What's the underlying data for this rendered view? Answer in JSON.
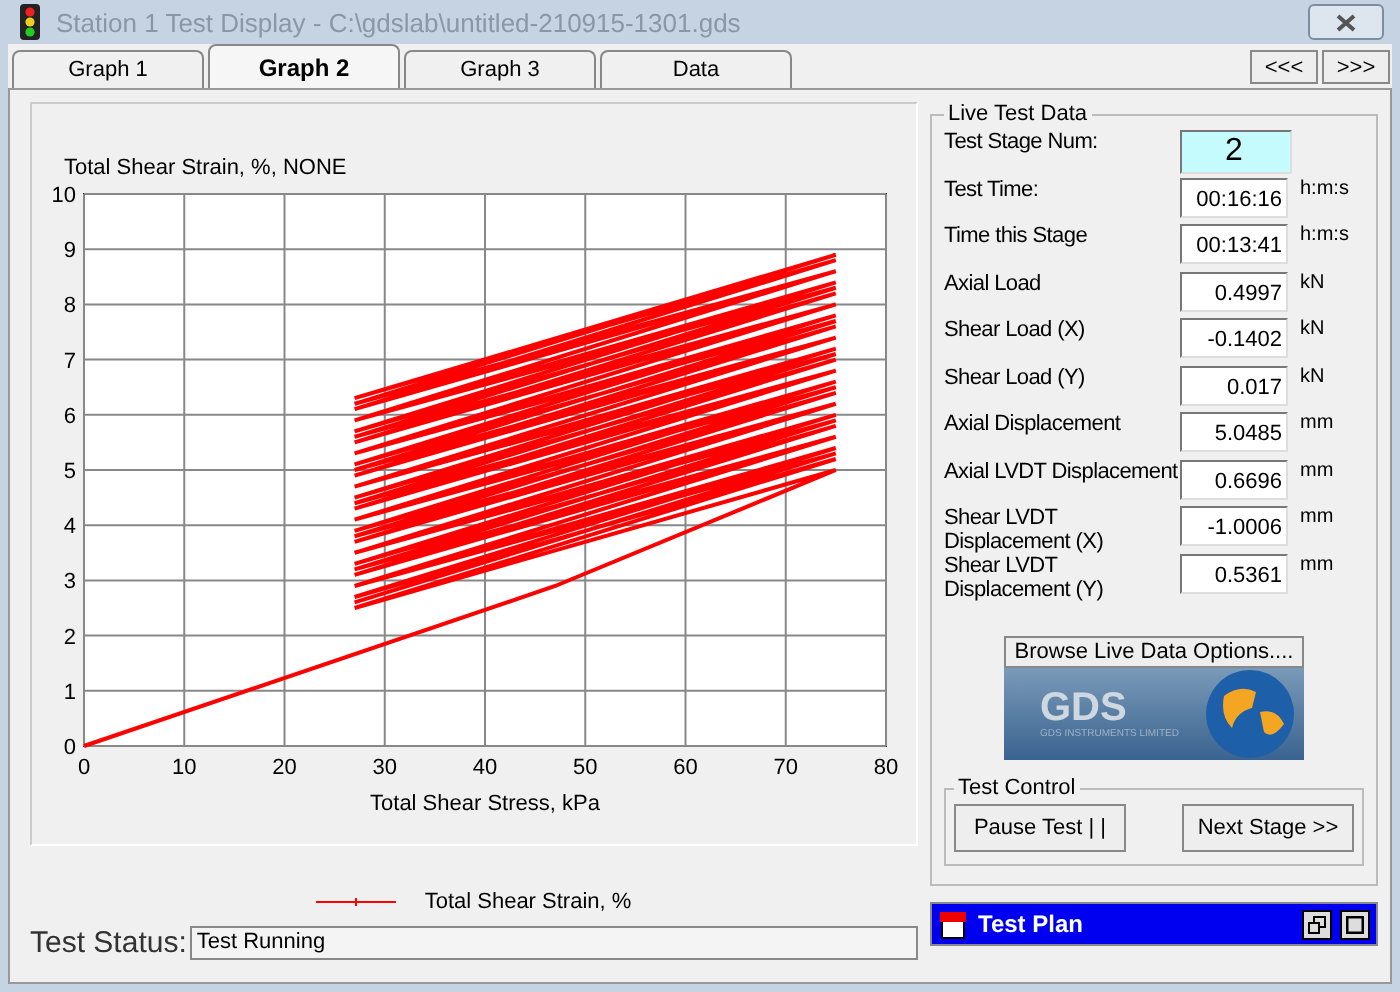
{
  "window": {
    "title": "Station 1 Test Display - C:\\gdslab\\untitled-210915-1301.gds"
  },
  "tabs": [
    {
      "label": "Graph 1",
      "selected": false
    },
    {
      "label": "Graph 2",
      "selected": true
    },
    {
      "label": "Graph 3",
      "selected": false
    },
    {
      "label": "Data",
      "selected": false
    }
  ],
  "nav_buttons": [
    "<<<",
    ">>>"
  ],
  "graph": {
    "chart_data": {
      "type": "line",
      "grid": true,
      "ylabel": "Total Shear Strain, %, NONE",
      "xlabel": "Total Shear Stress, kPa",
      "xlim": [
        0,
        80
      ],
      "ylim": [
        0,
        10
      ],
      "xticks": [
        0,
        10,
        20,
        30,
        40,
        50,
        60,
        70,
        80
      ],
      "yticks": [
        0,
        1,
        2,
        3,
        4,
        5,
        6,
        7,
        8,
        9,
        10
      ],
      "x": [
        0,
        47,
        75,
        27,
        75,
        27,
        75,
        27,
        75,
        27,
        75,
        27,
        75,
        27,
        75,
        27,
        75,
        27,
        75,
        27,
        75,
        27,
        75,
        27,
        75,
        27,
        75,
        27,
        75,
        27,
        75,
        27,
        75,
        27,
        75,
        27,
        75,
        27,
        75,
        27,
        75,
        27,
        75,
        27,
        75,
        27,
        75,
        27,
        75,
        27,
        75,
        27,
        75,
        27,
        75,
        27,
        75,
        27,
        75,
        27,
        75,
        27,
        75,
        27,
        75,
        27,
        75,
        27
      ],
      "series": [
        {
          "name": "Total Shear Strain, %",
          "color": "#ff0000",
          "values": [
            0,
            2.9,
            5.0,
            2.5,
            5.2,
            2.7,
            5.4,
            2.9,
            5.6,
            3.1,
            5.8,
            3.3,
            6.0,
            3.5,
            6.2,
            3.7,
            6.4,
            3.9,
            6.6,
            4.1,
            6.8,
            4.3,
            7.0,
            4.5,
            7.2,
            4.7,
            7.4,
            4.9,
            7.6,
            5.1,
            7.8,
            5.3,
            8.0,
            5.5,
            8.2,
            5.7,
            8.4,
            5.9,
            8.6,
            6.1,
            8.8,
            6.3,
            8.9,
            6.2,
            8.6,
            5.9,
            8.3,
            5.6,
            8.0,
            5.3,
            7.7,
            5.0,
            7.4,
            4.7,
            7.1,
            4.4,
            6.8,
            4.1,
            6.5,
            3.8,
            6.2,
            3.5,
            5.9,
            3.2,
            5.6,
            2.9,
            5.3,
            2.6
          ]
        }
      ]
    }
  },
  "live_data": {
    "title": "Live Test Data",
    "rows": [
      {
        "label": "Test Stage Num:",
        "value": "2",
        "highlighted": true
      },
      {
        "label": "Test Time:",
        "value": "00:16:16",
        "unit": "h:m:s",
        "highlighted": false
      },
      {
        "label": "Time this Stage",
        "value": "00:13:41",
        "unit": "h:m:s",
        "highlighted": false
      },
      {
        "label": "Axial Load",
        "value": "0.4997",
        "unit": "kN",
        "highlighted": false
      },
      {
        "label": "Shear Load (X)",
        "value": "-0.1402",
        "unit": "kN",
        "highlighted": false
      },
      {
        "label": "Shear Load (Y)",
        "value": "0.017",
        "unit": "kN",
        "highlighted": false
      },
      {
        "label": "Axial Displacement",
        "value": "5.0485",
        "unit": "mm",
        "highlighted": false
      },
      {
        "label": "Axial LVDT Displacement",
        "value": "0.6696",
        "unit": "mm",
        "highlighted": false
      },
      {
        "label": "Shear LVDT Displacement (X)",
        "value": "-1.0006",
        "unit": "mm",
        "highlighted": false
      },
      {
        "label": "Shear LVDT Displacement (Y)",
        "value": "0.5361",
        "unit": "mm",
        "highlighted": false
      }
    ],
    "browse_button": "Browse Live Data Options....",
    "logo": {
      "text": "GDS",
      "subtext": "GDS INSTRUMENTS LIMITED"
    }
  },
  "test_control": {
    "title": "Test Control",
    "buttons": [
      "Pause Test | |",
      "Next Stage >>"
    ]
  },
  "status": {
    "label": "Test Status:",
    "value": "Test Running"
  },
  "test_plan": {
    "title": "Test Plan"
  }
}
